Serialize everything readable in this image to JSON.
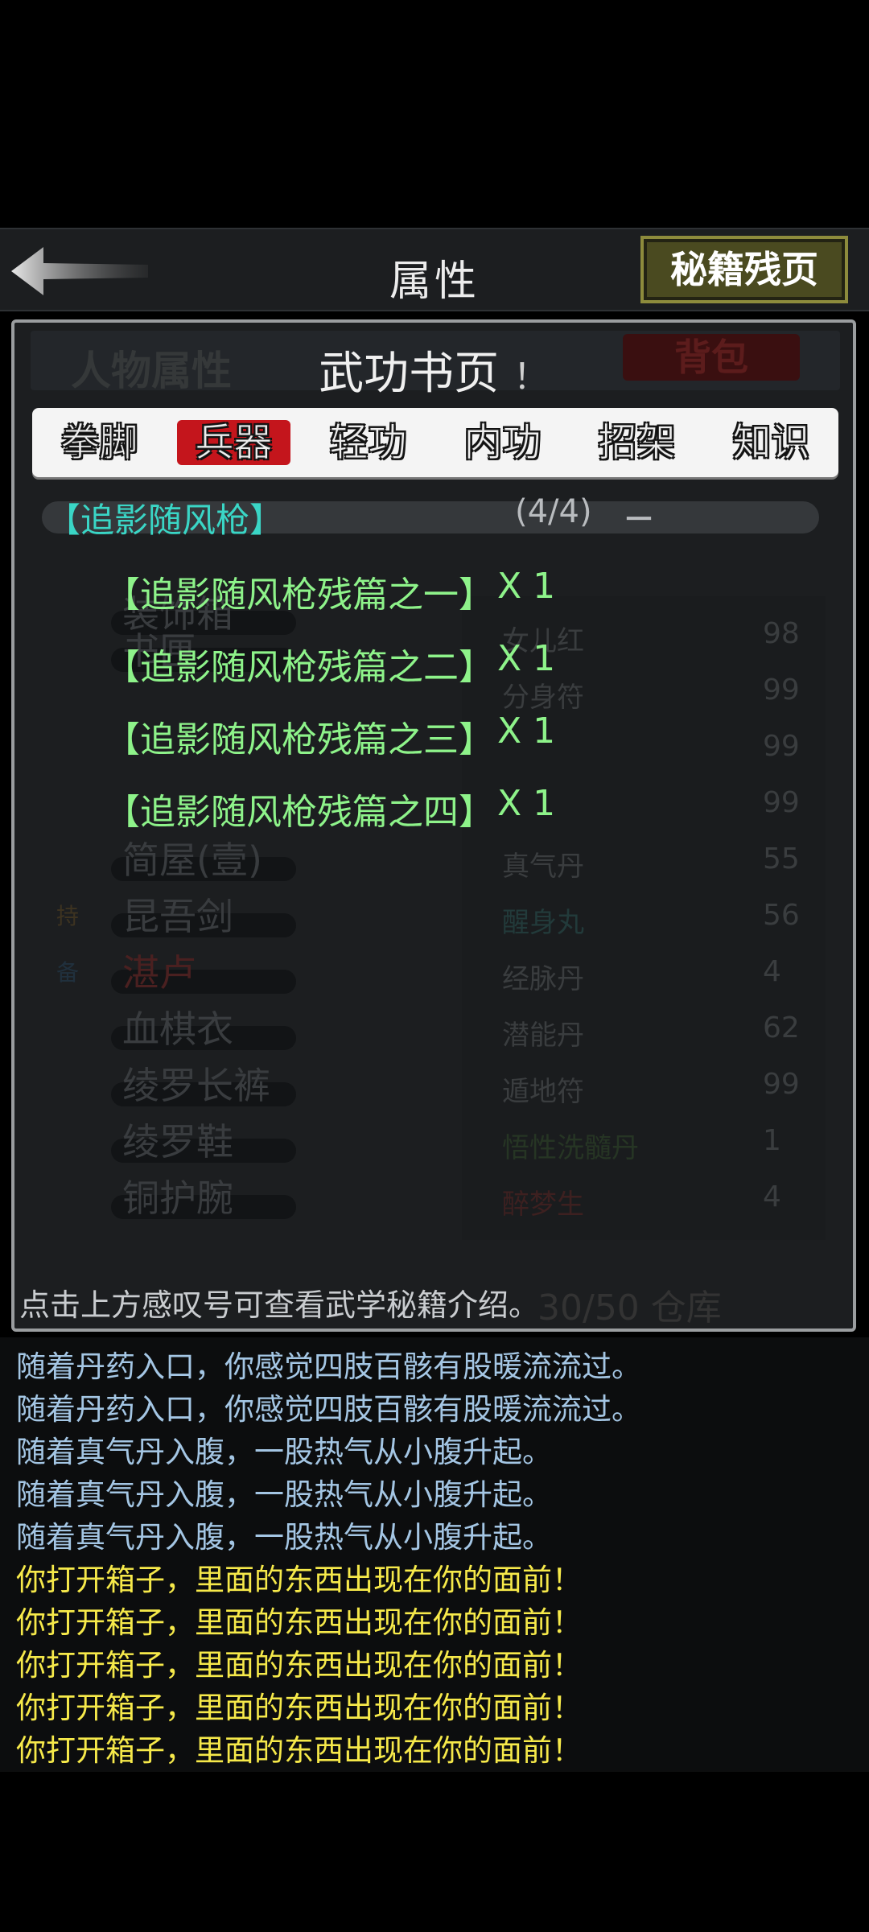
{
  "header": {
    "title": "属性",
    "secret_button_label": "秘籍残页"
  },
  "background_layer": {
    "tab_attributes": "人物属性",
    "tab_bag": "背包",
    "left_items": [
      "装饰箱",
      "书匣",
      "简屋(壹)",
      "昆吾剑",
      "湛卢",
      "血棋衣",
      "绫罗长裤",
      "绫罗鞋",
      "铜护腕"
    ],
    "right_items": [
      {
        "name": "女儿红",
        "count": "98"
      },
      {
        "name": "分身符",
        "count": "99"
      },
      {
        "name": "",
        "count": "99"
      },
      {
        "name": "",
        "count": "99"
      },
      {
        "name": "真气丹",
        "count": "55"
      },
      {
        "name": "醒身丸",
        "count": "56"
      },
      {
        "name": "经脉丹",
        "count": "4"
      },
      {
        "name": "潜能丹",
        "count": "62"
      },
      {
        "name": "遁地符",
        "count": "99"
      },
      {
        "name": "悟性洗髓丹",
        "count": "1"
      },
      {
        "name": "醉梦生",
        "count": "4"
      }
    ],
    "left_markers": [
      "持",
      "备"
    ],
    "storage": "30/50 仓库"
  },
  "panel": {
    "title": "武功书页",
    "title_mark": "！",
    "tabs": [
      {
        "label": "拳脚",
        "active": false
      },
      {
        "label": "兵器",
        "active": true
      },
      {
        "label": "轻功",
        "active": false
      },
      {
        "label": "内功",
        "active": false
      },
      {
        "label": "招架",
        "active": false
      },
      {
        "label": "知识",
        "active": false
      }
    ],
    "book": {
      "name": "【追影随风枪】",
      "progress": "(4/4)",
      "collapse": "－"
    },
    "pages": [
      {
        "name": "【追影随风枪残篇之一】",
        "qty": "X 1"
      },
      {
        "name": "【追影随风枪残篇之二】",
        "qty": "X 1"
      },
      {
        "name": "【追影随风枪残篇之三】",
        "qty": "X 1"
      },
      {
        "name": "【追影随风枪残篇之四】",
        "qty": "X 1"
      }
    ],
    "hint": "点击上方感叹号可查看武学秘籍介绍。"
  },
  "log": [
    {
      "text": "随着丹药入口，你感觉四肢百骸有股暖流流过。",
      "color": "#a4c6e4"
    },
    {
      "text": "随着丹药入口，你感觉四肢百骸有股暖流流过。",
      "color": "#a4c6e4"
    },
    {
      "text": "随着真气丹入腹，一股热气从小腹升起。",
      "color": "#a4c6e4"
    },
    {
      "text": "随着真气丹入腹，一股热气从小腹升起。",
      "color": "#a4c6e4"
    },
    {
      "text": "随着真气丹入腹，一股热气从小腹升起。",
      "color": "#a4c6e4"
    },
    {
      "text": "你打开箱子，里面的东西出现在你的面前！",
      "color": "#f6e94a"
    },
    {
      "text": "你打开箱子，里面的东西出现在你的面前！",
      "color": "#f6e94a"
    },
    {
      "text": "你打开箱子，里面的东西出现在你的面前！",
      "color": "#f6e94a"
    },
    {
      "text": "你打开箱子，里面的东西出现在你的面前！",
      "color": "#f6e94a"
    },
    {
      "text": "你打开箱子，里面的东西出现在你的面前！",
      "color": "#f6e94a"
    }
  ],
  "icons": {
    "back": "back-arrow-icon"
  }
}
